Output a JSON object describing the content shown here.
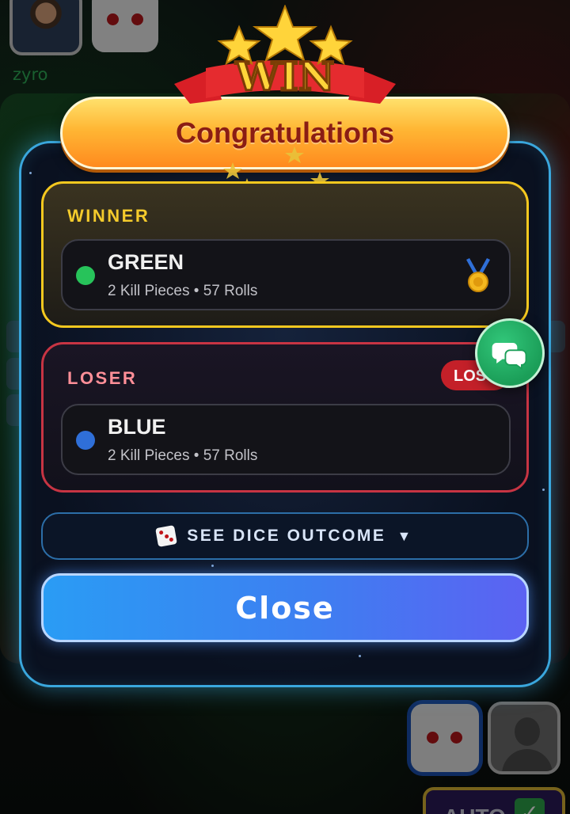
{
  "background": {
    "top_left_player": {
      "username": "zyro"
    },
    "auto_button": {
      "label": "AUTO"
    }
  },
  "modal": {
    "badge_text": "WIN",
    "title": "Congratulations",
    "winner": {
      "heading": "WINNER",
      "player_name": "GREEN",
      "stats": "2 Kill Pieces • 57 Rolls",
      "color": "#27c35a",
      "medal_icon": "first-place-medal"
    },
    "loser": {
      "heading": "LOSER",
      "badge": "LOST",
      "player_name": "BLUE",
      "stats": "2 Kill Pieces • 57 Rolls",
      "color": "#2f6fd8"
    },
    "dice_outcome_label": "SEE DICE OUTCOME",
    "close_label": "Close"
  },
  "colors": {
    "winner_accent": "#f4c81f",
    "loser_accent": "#c73443",
    "close_button": "#3d7ff1",
    "chat_button": "#1b9e58"
  }
}
